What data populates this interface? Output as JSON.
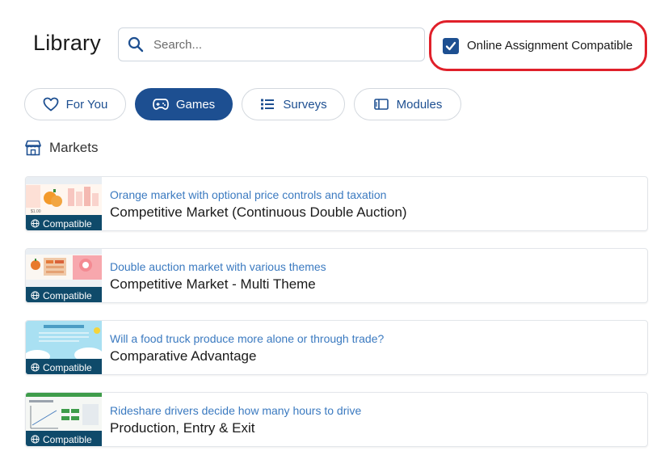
{
  "header": {
    "title": "Library",
    "search": {
      "placeholder": "Search...",
      "value": ""
    },
    "filter": {
      "label": "Online Assignment Compatible",
      "checked": true
    }
  },
  "tabs": [
    {
      "label": "For You",
      "icon": "heart-icon",
      "active": false
    },
    {
      "label": "Games",
      "icon": "gamepad-icon",
      "active": true
    },
    {
      "label": "Surveys",
      "icon": "list-icon",
      "active": false
    },
    {
      "label": "Modules",
      "icon": "module-icon",
      "active": false
    }
  ],
  "section": {
    "label": "Markets",
    "icon": "store-icon"
  },
  "items": [
    {
      "subtitle": "Orange market with optional price controls and taxation",
      "title": "Competitive Market (Continuous Double Auction)",
      "badge": "Compatible"
    },
    {
      "subtitle": "Double auction market with various themes",
      "title": "Competitive Market - Multi Theme",
      "badge": "Compatible"
    },
    {
      "subtitle": "Will a food truck produce more alone or through trade?",
      "title": "Comparative Advantage",
      "badge": "Compatible"
    },
    {
      "subtitle": "Rideshare drivers decide how many hours to drive",
      "title": "Production, Entry & Exit",
      "badge": "Compatible"
    }
  ],
  "colors": {
    "brand": "#1d4f91",
    "accent_link": "#3b7ac0",
    "badge": "#0f4a6a",
    "highlight": "#e0202a"
  }
}
